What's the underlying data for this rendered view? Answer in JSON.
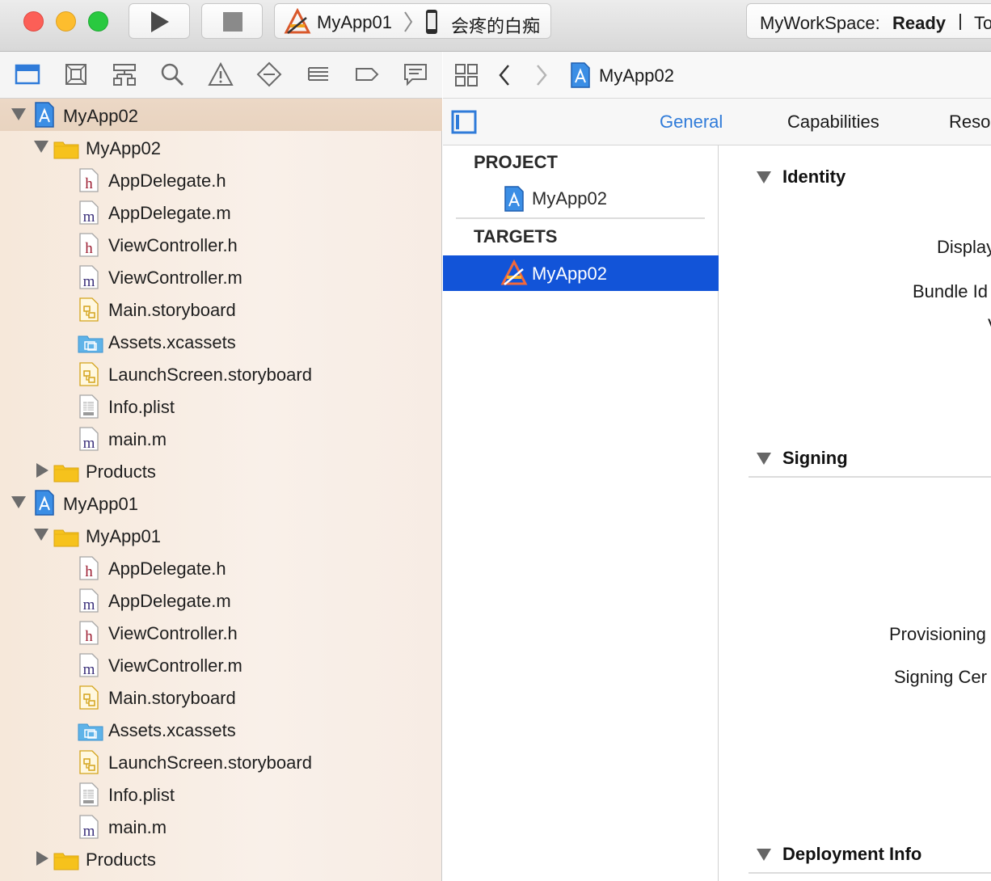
{
  "titlebar": {
    "scheme_target": "MyApp01",
    "scheme_device": "会疼的白痴",
    "status_workspace": "MyWorkSpace:",
    "status_state": "Ready",
    "status_more": "To"
  },
  "navigator": {
    "tree": [
      {
        "label": "MyApp02",
        "kind": "project",
        "depth": 0,
        "disclosure": "open",
        "selected": true
      },
      {
        "label": "MyApp02",
        "kind": "folder",
        "depth": 1,
        "disclosure": "open"
      },
      {
        "label": "AppDelegate.h",
        "kind": "h",
        "depth": 2
      },
      {
        "label": "AppDelegate.m",
        "kind": "m",
        "depth": 2
      },
      {
        "label": "ViewController.h",
        "kind": "h",
        "depth": 2
      },
      {
        "label": "ViewController.m",
        "kind": "m",
        "depth": 2
      },
      {
        "label": "Main.storyboard",
        "kind": "storyboard",
        "depth": 2
      },
      {
        "label": "Assets.xcassets",
        "kind": "assets",
        "depth": 2
      },
      {
        "label": "LaunchScreen.storyboard",
        "kind": "storyboard",
        "depth": 2
      },
      {
        "label": "Info.plist",
        "kind": "plist",
        "depth": 2
      },
      {
        "label": "main.m",
        "kind": "m",
        "depth": 2
      },
      {
        "label": "Products",
        "kind": "folder",
        "depth": 1,
        "disclosure": "closed"
      },
      {
        "label": "MyApp01",
        "kind": "project",
        "depth": 0,
        "disclosure": "open"
      },
      {
        "label": "MyApp01",
        "kind": "folder",
        "depth": 1,
        "disclosure": "open"
      },
      {
        "label": "AppDelegate.h",
        "kind": "h",
        "depth": 2
      },
      {
        "label": "AppDelegate.m",
        "kind": "m",
        "depth": 2
      },
      {
        "label": "ViewController.h",
        "kind": "h",
        "depth": 2
      },
      {
        "label": "ViewController.m",
        "kind": "m",
        "depth": 2
      },
      {
        "label": "Main.storyboard",
        "kind": "storyboard",
        "depth": 2
      },
      {
        "label": "Assets.xcassets",
        "kind": "assets",
        "depth": 2
      },
      {
        "label": "LaunchScreen.storyboard",
        "kind": "storyboard",
        "depth": 2
      },
      {
        "label": "Info.plist",
        "kind": "plist",
        "depth": 2
      },
      {
        "label": "main.m",
        "kind": "m",
        "depth": 2
      },
      {
        "label": "Products",
        "kind": "folder",
        "depth": 1,
        "disclosure": "closed"
      }
    ]
  },
  "editor": {
    "breadcrumb": "MyApp02",
    "tabs": [
      "General",
      "Capabilities",
      "Reso"
    ],
    "active_tab": "General",
    "project_header": "PROJECT",
    "project_item": "MyApp02",
    "targets_header": "TARGETS",
    "target_item": "MyApp02",
    "sections": {
      "identity": "Identity",
      "signing": "Signing",
      "deployment": "Deployment Info"
    },
    "fields": {
      "display": "Display",
      "bundle_id": "Bundle Id",
      "version_fragment": "V",
      "provisioning": "Provisioning",
      "signing_cert": "Signing Cer"
    }
  },
  "colors": {
    "accent": "#1254d8",
    "tab_active": "#2f7bd9",
    "folder": "#f6c21c",
    "assets": "#5fb3e8"
  }
}
